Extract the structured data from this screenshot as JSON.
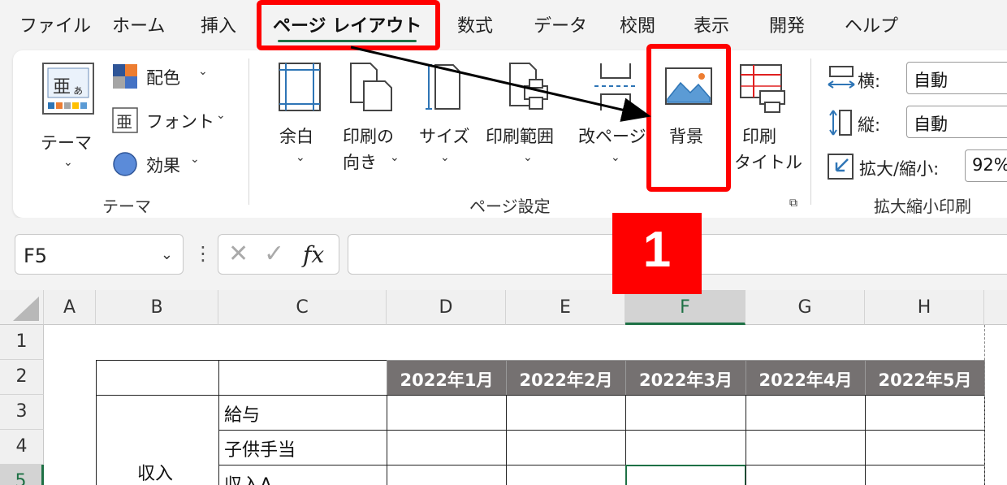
{
  "menu_tabs": [
    {
      "label": "ファイル"
    },
    {
      "label": "ホーム"
    },
    {
      "label": "挿入"
    },
    {
      "label": "ページ レイアウト",
      "active": true
    },
    {
      "label": "数式"
    },
    {
      "label": "データ"
    },
    {
      "label": "校閲"
    },
    {
      "label": "表示"
    },
    {
      "label": "開発"
    },
    {
      "label": "ヘルプ"
    }
  ],
  "ribbon": {
    "theme_group": {
      "theme_button": "テーマ",
      "colors": "配色",
      "fonts": "フォント",
      "effects": "効果",
      "label": "テーマ"
    },
    "page_setup_group": {
      "margins": "余白",
      "orientation_line1": "印刷の",
      "orientation_line2": "向き",
      "size": "サイズ",
      "print_area": "印刷範囲",
      "breaks": "改ページ",
      "background": "背景",
      "print_titles_line1": "印刷",
      "print_titles_line2": "タイトル",
      "label": "ページ設定"
    },
    "scale_group": {
      "width_label": "横:",
      "width_value": "自動",
      "height_label": "縦:",
      "height_value": "自動",
      "scale_label": "拡大/縮小:",
      "scale_value": "92%",
      "label": "拡大縮小印刷"
    }
  },
  "formula_bar": {
    "name_box": "F5",
    "fx": "fx",
    "value": ""
  },
  "sheet": {
    "columns": [
      "A",
      "B",
      "C",
      "D",
      "E",
      "F",
      "G",
      "H"
    ],
    "rows": [
      "1",
      "2",
      "3",
      "4",
      "5"
    ],
    "months": [
      "2022年1月",
      "2022年2月",
      "2022年3月",
      "2022年4月",
      "2022年5月"
    ],
    "c3": "給与",
    "c4": "子供手当",
    "c5": "収入A",
    "b_income": "収入"
  },
  "annotation": {
    "step": "1",
    "color": "#ff0000"
  }
}
